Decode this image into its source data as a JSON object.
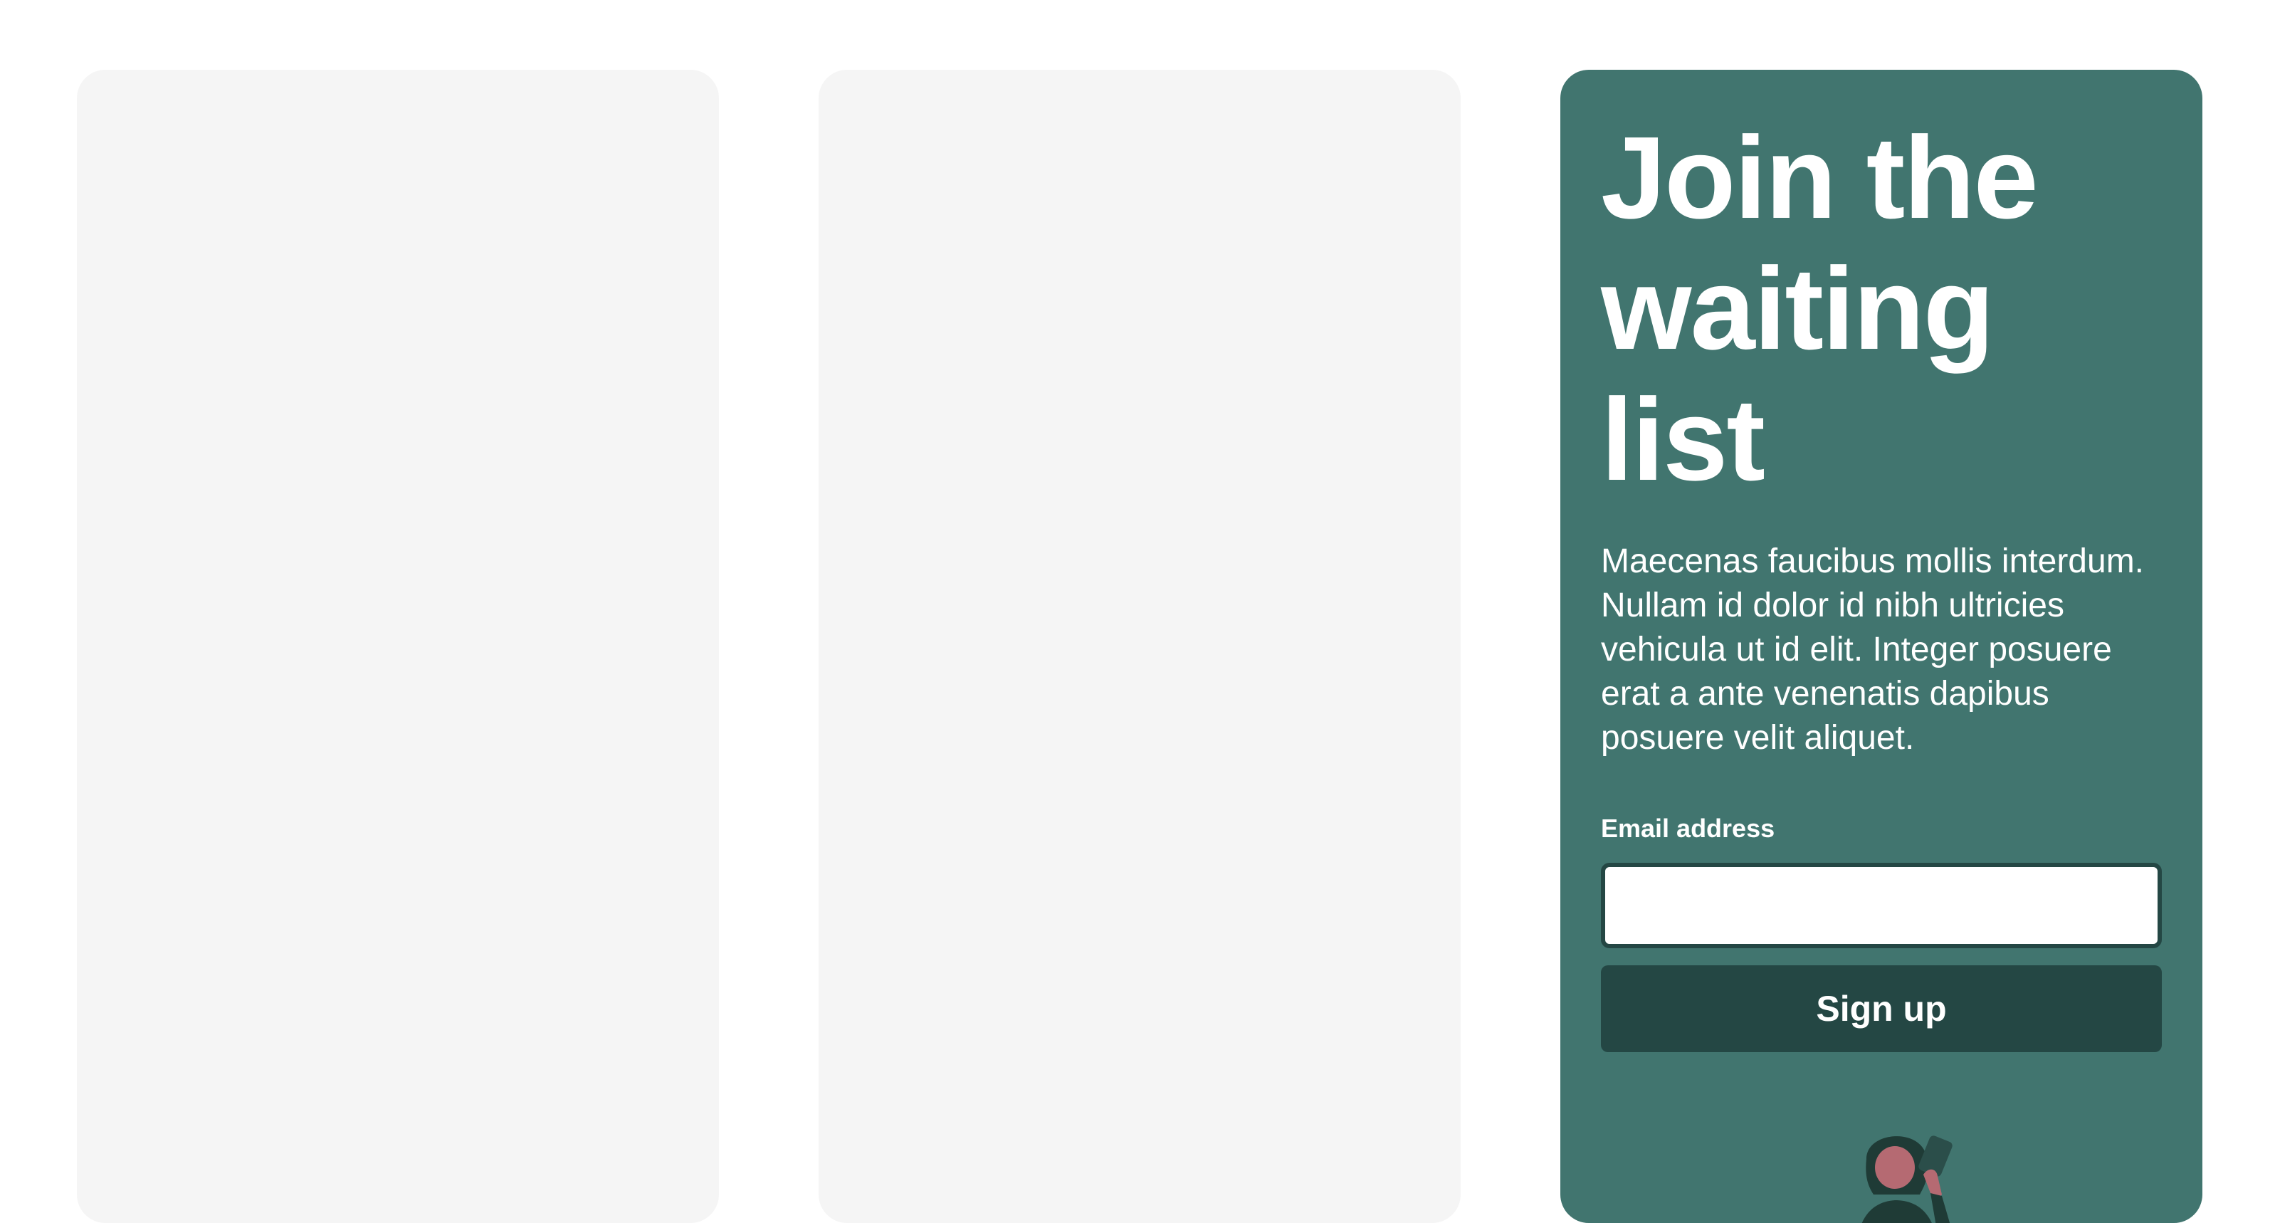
{
  "signup_card": {
    "title": "Join the waiting list",
    "description": "Maecenas faucibus mollis interdum. Nullam id dolor id nibh ultricies vehicula ut id elit. Integer posuere erat a ante venenatis dapibus posuere velit aliquet.",
    "email_label": "Email address",
    "email_value": "",
    "button_label": "Sign up",
    "illustration_icon": "person-with-phone-illustration"
  },
  "colors": {
    "page_background": "#ffffff",
    "placeholder_card": "#f5f5f5",
    "accent_card": "#41756f",
    "button_background": "#244744",
    "input_border": "#244744"
  }
}
